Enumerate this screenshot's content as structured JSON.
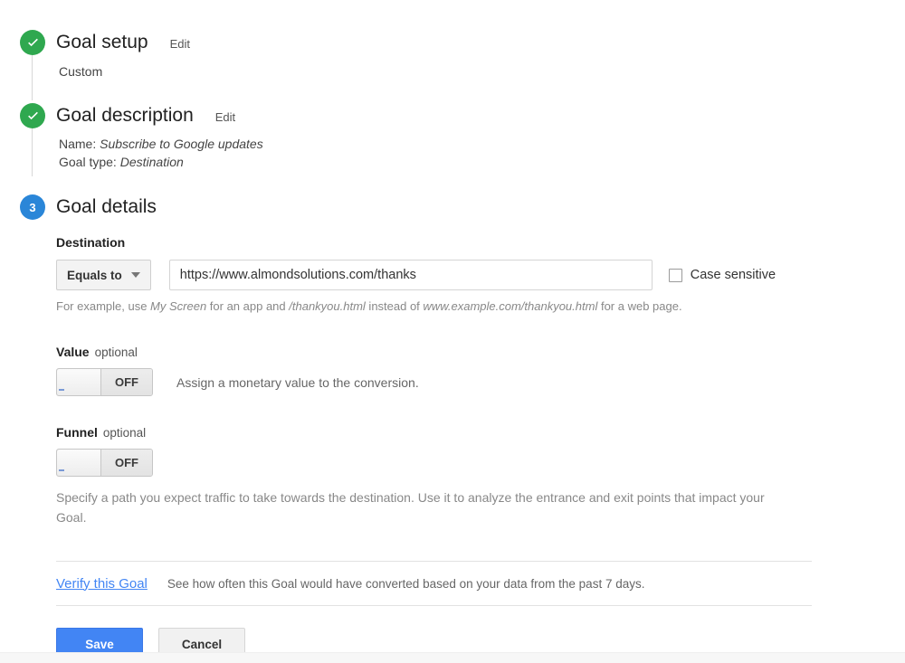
{
  "steps": [
    {
      "marker": "check",
      "title": "Goal setup",
      "edit_label": "Edit",
      "summary": "Custom"
    },
    {
      "marker": "check",
      "title": "Goal description",
      "edit_label": "Edit",
      "name_label": "Name:",
      "name_value": "Subscribe to Google updates",
      "type_label": "Goal type:",
      "type_value": "Destination"
    },
    {
      "marker": "3",
      "title": "Goal details"
    }
  ],
  "details": {
    "destination": {
      "label": "Destination",
      "match_type": "Equals to",
      "match_caret_icon": "chevron-down-icon",
      "url_value": "https://www.almondsolutions.com/thanks",
      "url_placeholder": "",
      "case_sensitive_label": "Case sensitive",
      "case_sensitive_checked": false,
      "help_prefix": "For example, use ",
      "help_italic_1": "My Screen",
      "help_mid_1": " for an app and ",
      "help_italic_2": "/thankyou.html",
      "help_mid_2": " instead of ",
      "help_italic_3": "www.example.com/thankyou.html",
      "help_suffix": " for a web page."
    },
    "value": {
      "label": "Value",
      "optional_label": "optional",
      "toggle_state": "OFF",
      "description": "Assign a monetary value to the conversion."
    },
    "funnel": {
      "label": "Funnel",
      "optional_label": "optional",
      "toggle_state": "OFF",
      "description": "Specify a path you expect traffic to take towards the destination. Use it to analyze the entrance and exit points that impact your Goal."
    },
    "verify": {
      "link_label": "Verify this Goal",
      "description": "See how often this Goal would have converted based on your data from the past 7 days."
    },
    "actions": {
      "save_label": "Save",
      "cancel_label": "Cancel"
    }
  },
  "colors": {
    "step_done": "#2fa84f",
    "step_active": "#2a86d8",
    "primary_button": "#4285f4",
    "link": "#4285f4"
  }
}
